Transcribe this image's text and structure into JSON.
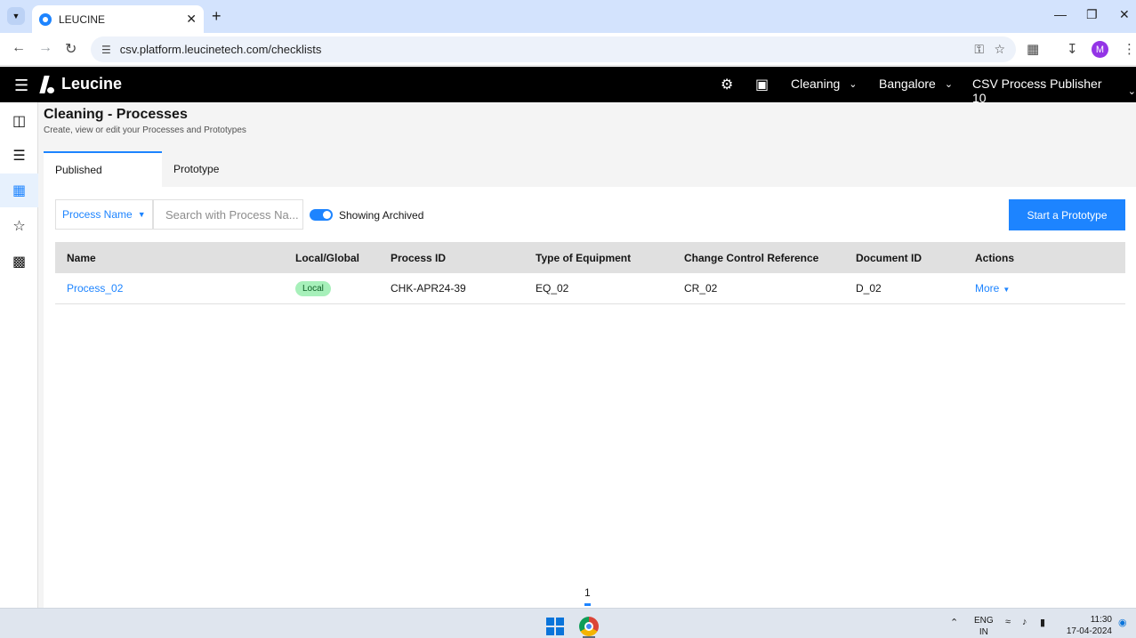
{
  "browser": {
    "tab_title": "LEUCINE",
    "url": "csv.platform.leucinetech.com/checklists",
    "avatar_letter": "M"
  },
  "header": {
    "brand": "Leucine",
    "use_case": "Cleaning",
    "facility": "Bangalore",
    "user": "CSV Process Publisher 10"
  },
  "page": {
    "title": "Cleaning - Processes",
    "subtitle": "Create, view or edit your Processes and Prototypes",
    "tabs": [
      {
        "label": "Published",
        "active": true
      },
      {
        "label": "Prototype",
        "active": false
      }
    ]
  },
  "filters": {
    "dropdown_label": "Process Name",
    "search_placeholder": "Search with Process Na...",
    "toggle_label": "Showing Archived",
    "toggle_on": true,
    "primary_action": "Start a Prototype"
  },
  "table": {
    "columns": [
      "Name",
      "Local/Global",
      "Process ID",
      "Type of Equipment",
      "Change Control Reference",
      "Document ID",
      "Actions"
    ],
    "rows": [
      {
        "name": "Process_02",
        "scope": "Local",
        "process_id": "CHK-APR24-39",
        "equipment": "EQ_02",
        "ccr": "CR_02",
        "document_id": "D_02",
        "action": "More"
      }
    ]
  },
  "pagination": {
    "current": "1"
  },
  "taskbar": {
    "lang_line1": "ENG",
    "lang_line2": "IN",
    "time": "11:30",
    "date": "17-04-2024"
  },
  "colors": {
    "accent": "#1d84ff",
    "header_bg": "#000000",
    "badge_bg": "#a7f0ba"
  }
}
